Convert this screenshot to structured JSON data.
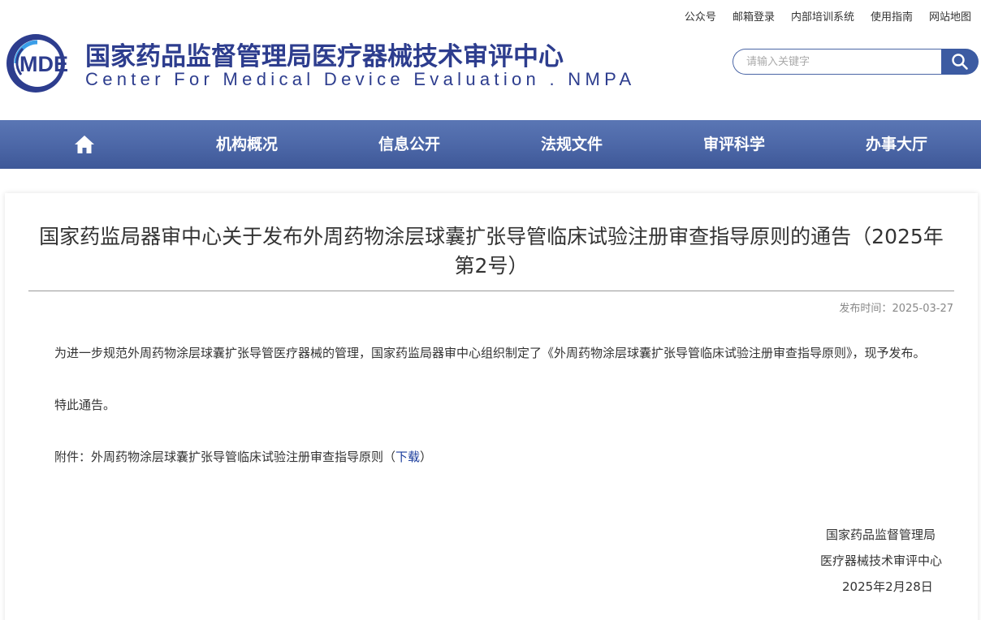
{
  "top_links": [
    "公众号",
    "邮箱登录",
    "内部培训系统",
    "使用指南",
    "网站地图"
  ],
  "logo": {
    "text": "MDE"
  },
  "site": {
    "title_cn": "国家药品监督管理局医疗器械技术审评中心",
    "title_en": "Center For Medical Device Evaluation . NMPA"
  },
  "search": {
    "placeholder": "请输入关键字",
    "icon": "search-icon"
  },
  "nav": {
    "home_icon": "home-icon",
    "items": [
      "机构概况",
      "信息公开",
      "法规文件",
      "审评科学",
      "办事大厅"
    ]
  },
  "article": {
    "title": "国家药监局器审中心关于发布外周药物涂层球囊扩张导管临床试验注册审查指导原则的通告（2025年第2号）",
    "pub_label": "发布时间：",
    "pub_date": "2025-03-27",
    "para1": "为进一步规范外周药物涂层球囊扩张导管医疗器械的管理，国家药监局器审中心组织制定了《外周药物涂层球囊扩张导管临床试验注册审查指导原则》，现予发布。",
    "para2": "特此通告。",
    "attachment_prefix": "附件：外周药物涂层球囊扩张导管临床试验注册审查指导原则（",
    "attachment_link": "下载",
    "attachment_suffix": "）",
    "sign_org1": "国家药品监督管理局",
    "sign_org2": "医疗器械技术审评中心",
    "sign_date": "2025年2月28日"
  },
  "colors": {
    "brand": "#2d3d8e",
    "nav_bg": "#4d68a8",
    "link": "#1a3c9c"
  }
}
